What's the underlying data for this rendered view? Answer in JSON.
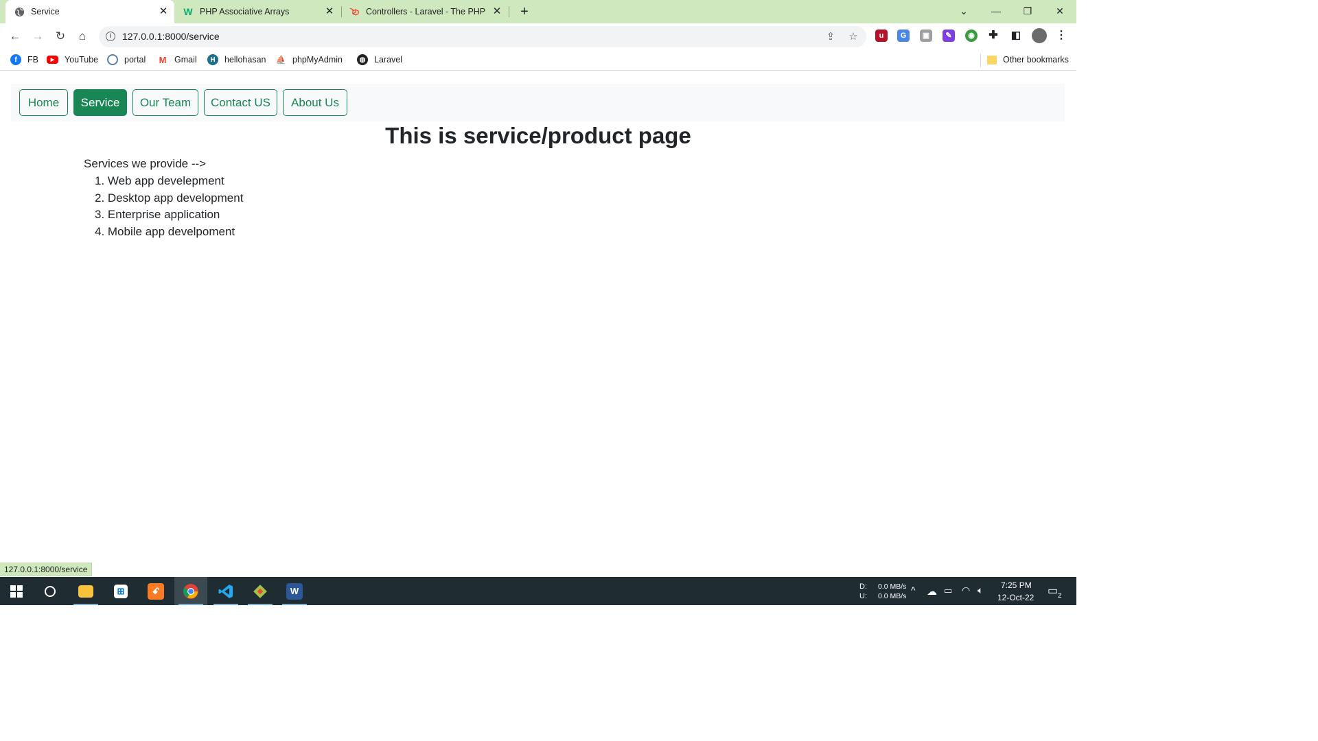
{
  "browser": {
    "tabs": [
      {
        "title": "Service",
        "active": true
      },
      {
        "title": "PHP Associative Arrays",
        "active": false
      },
      {
        "title": "Controllers - Laravel - The PHP Fr",
        "active": false
      }
    ],
    "new_tab": "+",
    "window_controls": {
      "dropdown": "⌄",
      "minimize": "—",
      "restore": "❐",
      "close": "✕"
    },
    "url": "127.0.0.1:8000/service",
    "bookmarks": [
      {
        "label": "FB",
        "color": "#1877f2"
      },
      {
        "label": "YouTube",
        "color": "#ff0000"
      },
      {
        "label": "portal",
        "color": "#5b7fa3"
      },
      {
        "label": "Gmail",
        "color": "#ea4335"
      },
      {
        "label": "hellohasan",
        "color": "#1c6e8c"
      },
      {
        "label": "phpMyAdmin",
        "color": "#f29111"
      },
      {
        "label": "Laravel",
        "color": "#202124"
      }
    ],
    "other_bookmarks": "Other bookmarks",
    "status_url": "127.0.0.1:8000/service"
  },
  "page": {
    "nav": [
      {
        "label": "Home",
        "active": false
      },
      {
        "label": "Service",
        "active": true
      },
      {
        "label": "Our Team",
        "active": false
      },
      {
        "label": "Contact US",
        "active": false
      },
      {
        "label": "About Us",
        "active": false
      }
    ],
    "heading": "This is service/product page",
    "intro": "Services we provide -->",
    "services": [
      "1. Web app develepment",
      "2. Desktop app development",
      "3. Enterprise application",
      "4. Mobile app develpoment"
    ]
  },
  "taskbar": {
    "net_down_label": "D:",
    "net_up_label": "U:",
    "net_down": "0.0 MB/s",
    "net_up": "0.0 MB/s",
    "time": "7:25 PM",
    "date": "12-Oct-22",
    "notifications": "2"
  },
  "colors": {
    "accent": "#198754",
    "tabstrip": "#cfe8bd",
    "taskbar": "#1f2d33"
  }
}
